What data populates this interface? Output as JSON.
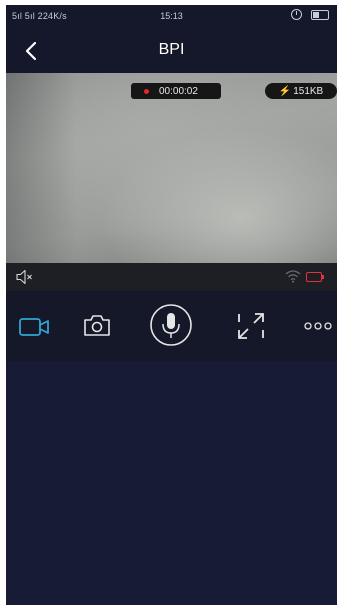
{
  "status_bar": {
    "signal": "5ıl 5ıl 224K/s",
    "time": "15:13"
  },
  "nav": {
    "title": "BPI",
    "back_icon": "chevron-left-icon"
  },
  "video": {
    "recording_time": "00:00:02",
    "data_size": "151KB",
    "recording_color": "#e8262c"
  },
  "info_bar": {
    "mute_icon": "speaker-muted-icon",
    "wifi_icon": "wifi-icon",
    "battery_icon": "battery-low-icon",
    "battery_color": "#e2333b"
  },
  "controls": {
    "accent_color": "#2fa6d3",
    "items": [
      {
        "icon": "video-record-icon",
        "active": true
      },
      {
        "icon": "camera-icon",
        "active": false
      },
      {
        "icon": "microphone-icon",
        "active": false
      },
      {
        "icon": "fullscreen-icon",
        "active": false
      },
      {
        "icon": "more-icon",
        "active": false
      }
    ]
  }
}
